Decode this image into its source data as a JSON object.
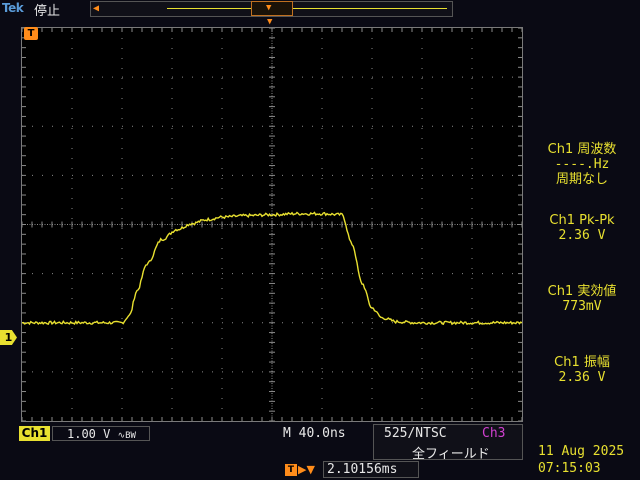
{
  "header": {
    "brand": "Tek",
    "status": "停止"
  },
  "markers": {
    "trigger_position": "T",
    "channel_ground": "1"
  },
  "measurements": [
    {
      "label": "Ch1 周波数",
      "value": "----.Hz",
      "extra": "周期なし"
    },
    {
      "label": "Ch1 Pk-Pk",
      "value": "2.36 V"
    },
    {
      "label": "Ch1 実効値",
      "value": "773mV"
    },
    {
      "label": "Ch1 振幅",
      "value": "2.36 V"
    }
  ],
  "footer": {
    "channel": "Ch1",
    "volts_per_div": "1.00 V",
    "bw_limit_icon": "∿BW",
    "timebase": "M 40.0ns",
    "trigger_source": "525/NTSC",
    "trigger_channel": "Ch3",
    "trigger_field": "全フィールド",
    "horizontal_position": "2.10156ms",
    "date": "11 Aug 2025",
    "time": "07:15:03"
  },
  "colors": {
    "trace": "#e8e030",
    "trigger": "#ff8c1a",
    "grid": "#8a8a8a"
  },
  "chart_data": {
    "type": "line",
    "xlabel": "",
    "ylabel": "",
    "xlim": [
      -5,
      5
    ],
    "ylim": [
      -4,
      4
    ],
    "series": [
      {
        "x": [
          -5,
          -3.0,
          -2.85,
          -2.7,
          -2.5,
          -2.2,
          -1.9,
          -1.6,
          -1.3,
          -1.0,
          -0.5,
          0,
          0.5,
          1.0,
          1.4,
          1.6,
          1.8,
          2.0,
          2.2,
          2.5,
          2.9,
          5
        ],
        "values": [
          -2.0,
          -2.0,
          -1.85,
          -1.35,
          -0.8,
          -0.3,
          -0.1,
          0.02,
          0.1,
          0.15,
          0.18,
          0.2,
          0.22,
          0.22,
          0.2,
          -0.4,
          -1.2,
          -1.7,
          -1.9,
          -1.98,
          -2.0,
          -2.0
        ]
      }
    ],
    "grid": true
  }
}
